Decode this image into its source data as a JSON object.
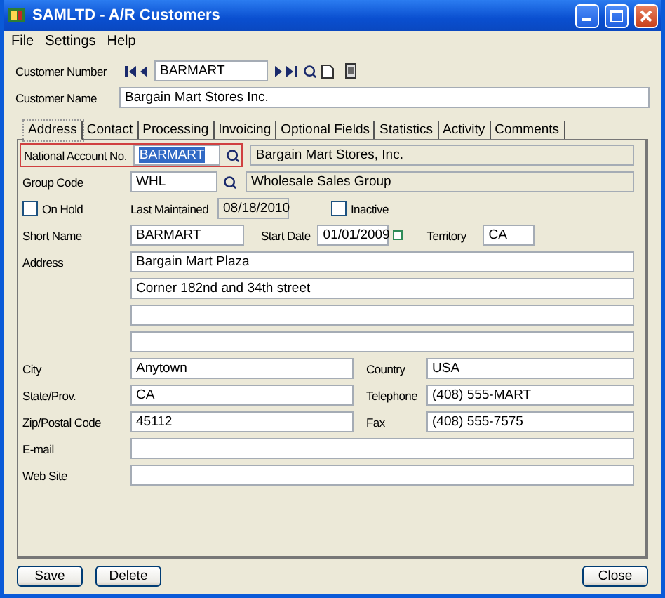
{
  "window": {
    "title": "SAMLTD - A/R Customers"
  },
  "menu": [
    "File",
    "Settings",
    "Help"
  ],
  "customer_number": {
    "label": "Customer Number",
    "value": "BARMART"
  },
  "customer_name": {
    "label": "Customer Name",
    "value": "Bargain Mart Stores Inc."
  },
  "tabs": [
    {
      "label": "Address",
      "selected": true
    },
    {
      "label": "Contact",
      "selected": false
    },
    {
      "label": "Processing",
      "selected": false
    },
    {
      "label": "Invoicing",
      "selected": false
    },
    {
      "label": "Optional Fields",
      "selected": false
    },
    {
      "label": "Statistics",
      "selected": false
    },
    {
      "label": "Activity",
      "selected": false
    },
    {
      "label": "Comments",
      "selected": false
    }
  ],
  "national_account": {
    "label": "National Account No.",
    "value": "BARMART",
    "focused": true,
    "description": "Bargain Mart Stores, Inc."
  },
  "group_code": {
    "label": "Group Code",
    "value": "WHL",
    "description": "Wholesale Sales Group"
  },
  "on_hold": {
    "label": "On Hold",
    "checked": false
  },
  "last_maintained": {
    "label": "Last Maintained",
    "value": "08/18/2010"
  },
  "inactive": {
    "label": "Inactive",
    "checked": false
  },
  "short_name": {
    "label": "Short Name",
    "value": "BARMART"
  },
  "start_date": {
    "label": "Start Date",
    "value": "01/01/2009"
  },
  "territory": {
    "label": "Territory",
    "value": "CA"
  },
  "address": {
    "label": "Address",
    "lines": [
      {
        "kind": "filled",
        "value": "Bargain Mart Plaza"
      },
      {
        "kind": "filled",
        "value": "Corner 182nd and 34th street"
      },
      {
        "kind": "blank"
      },
      {
        "kind": "blank"
      }
    ]
  },
  "city": {
    "label": "City",
    "value": "Anytown"
  },
  "country": {
    "label": "Country",
    "value": "USA"
  },
  "state": {
    "label": "State/Prov.",
    "value": "CA"
  },
  "telephone": {
    "label": "Telephone",
    "value": "(408) 555-MART"
  },
  "zip": {
    "label": "Zip/Postal Code",
    "value": "45112"
  },
  "fax": {
    "label": "Fax",
    "value": "(408) 555-7575"
  },
  "email": {
    "label": "E-mail"
  },
  "web_site": {
    "label": "Web Site"
  },
  "buttons": [
    "Save",
    "Delete"
  ],
  "close_button": "Close"
}
